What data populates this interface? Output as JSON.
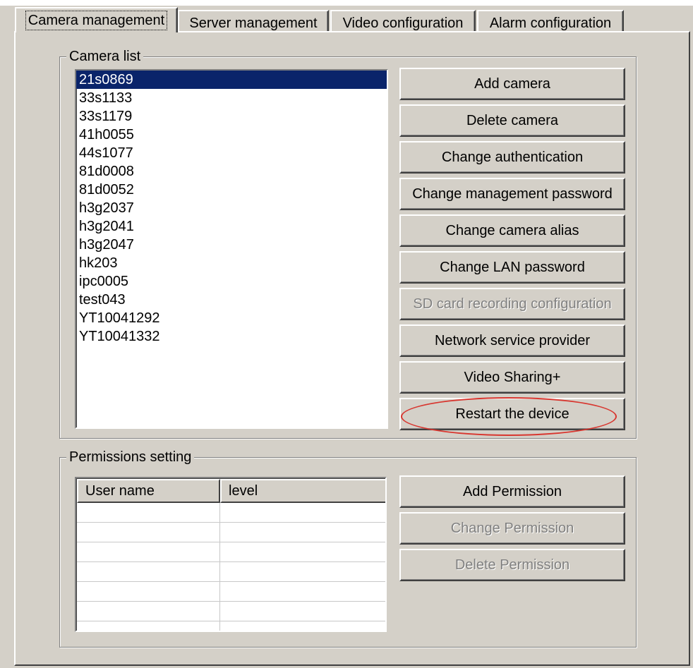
{
  "tabs": [
    {
      "label": "Camera management",
      "active": true
    },
    {
      "label": "Server management",
      "active": false
    },
    {
      "label": "Video configuration",
      "active": false
    },
    {
      "label": "Alarm configuration",
      "active": false
    }
  ],
  "camera_list": {
    "title": "Camera list",
    "selected": "21s0869",
    "items": [
      "21s0869",
      "33s1133",
      "33s1179",
      "41h0055",
      "44s1077",
      "81d0008",
      "81d0052",
      "h3g2037",
      "h3g2041",
      "h3g2047",
      "hk203",
      "ipc0005",
      "test043",
      "YT10041292",
      "YT10041332"
    ]
  },
  "camera_buttons": [
    {
      "label": "Add camera",
      "enabled": true
    },
    {
      "label": "Delete camera",
      "enabled": true
    },
    {
      "label": "Change authentication",
      "enabled": true
    },
    {
      "label": "Change management password",
      "enabled": true
    },
    {
      "label": "Change camera alias",
      "enabled": true
    },
    {
      "label": "Change LAN password",
      "enabled": true
    },
    {
      "label": "SD card recording configuration",
      "enabled": false
    },
    {
      "label": "Network service provider",
      "enabled": true
    },
    {
      "label": "Video Sharing+",
      "enabled": true
    },
    {
      "label": "Restart the device",
      "enabled": true,
      "highlighted": true
    }
  ],
  "permissions": {
    "title": "Permissions setting",
    "columns": [
      "User name",
      "level"
    ],
    "rows": [],
    "buttons": [
      {
        "label": "Add Permission",
        "enabled": true
      },
      {
        "label": "Change Permission",
        "enabled": false
      },
      {
        "label": "Delete Permission",
        "enabled": false
      }
    ]
  },
  "colors": {
    "face": "#d4d0c8",
    "selection": "#0a246a",
    "highlight_oval": "#d8362f",
    "disabled_text": "#808080"
  }
}
